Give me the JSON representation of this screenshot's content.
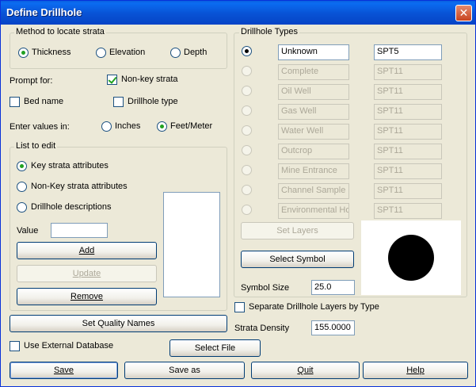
{
  "window": {
    "title": "Define Drillhole",
    "close_glyph": "✕"
  },
  "method": {
    "group_label": "Method to locate strata",
    "options": [
      {
        "label": "Thickness",
        "checked": true
      },
      {
        "label": "Elevation",
        "checked": false
      },
      {
        "label": "Depth",
        "checked": false
      }
    ]
  },
  "prompt": {
    "label": "Prompt for:",
    "non_key_strata": {
      "label": "Non-key strata",
      "checked": true
    },
    "bed_name": {
      "label": "Bed name",
      "checked": false
    },
    "drillhole_type": {
      "label": "Drillhole type",
      "checked": false
    }
  },
  "enter_values": {
    "label": "Enter values in:",
    "inches": {
      "label": "Inches",
      "checked": false
    },
    "feet_meter": {
      "label": "Feet/Meter",
      "checked": true
    }
  },
  "list_to_edit": {
    "group_label": "List to edit",
    "options": [
      {
        "label": "Key strata attributes",
        "checked": true
      },
      {
        "label": "Non-Key strata attributes",
        "checked": false
      },
      {
        "label": "Drillhole descriptions",
        "checked": false
      }
    ],
    "value_label": "Value",
    "value": "",
    "add_label": "Add",
    "update_label": "Update",
    "remove_label": "Remove"
  },
  "set_quality_names_label": "Set Quality Names",
  "use_external_db": {
    "label": "Use External Database",
    "checked": false
  },
  "select_file_label": "Select File",
  "drillhole_types": {
    "group_label": "Drillhole Types",
    "rows": [
      {
        "name": "Unknown",
        "code": "SPT5",
        "selected": true,
        "enabled": true
      },
      {
        "name": "Complete",
        "code": "SPT11",
        "selected": false,
        "enabled": false
      },
      {
        "name": "Oil Well",
        "code": "SPT11",
        "selected": false,
        "enabled": false
      },
      {
        "name": "Gas Well",
        "code": "SPT11",
        "selected": false,
        "enabled": false
      },
      {
        "name": "Water Well",
        "code": "SPT11",
        "selected": false,
        "enabled": false
      },
      {
        "name": "Outcrop",
        "code": "SPT11",
        "selected": false,
        "enabled": false
      },
      {
        "name": "Mine Entrance",
        "code": "SPT11",
        "selected": false,
        "enabled": false
      },
      {
        "name": "Channel Sample",
        "code": "SPT11",
        "selected": false,
        "enabled": false
      },
      {
        "name": "Environmental Hol",
        "code": "SPT11",
        "selected": false,
        "enabled": false
      }
    ],
    "set_layers_label": "Set Layers",
    "select_symbol_label": "Select Symbol",
    "symbol_size_label": "Symbol Size",
    "symbol_size": "25.0",
    "symbol_icon": "filled-circle"
  },
  "separate_layers": {
    "label": "Separate Drillhole Layers by Type",
    "checked": false
  },
  "strata_density": {
    "label": "Strata Density",
    "value": "155.0000"
  },
  "footer": {
    "save_label": "Save",
    "save_as_label": "Save as",
    "quit_label": "Quit",
    "help_label": "Help"
  }
}
